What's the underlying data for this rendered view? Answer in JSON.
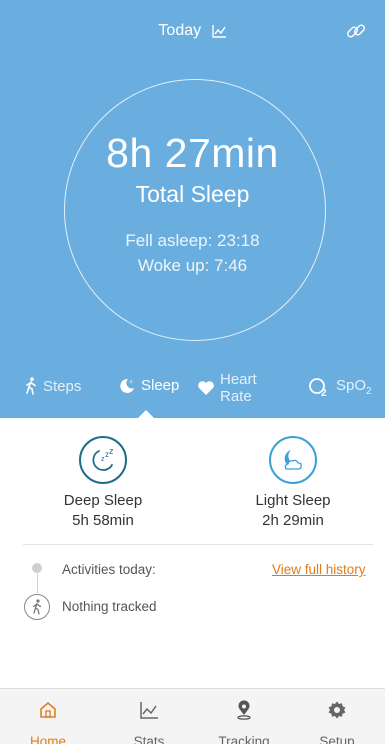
{
  "header": {
    "title": "Today",
    "title_icon": "line-chart-icon",
    "right_icon": "link-icon"
  },
  "summary": {
    "total_time": "8h 27min",
    "total_label": "Total Sleep",
    "fell_asleep": "Fell asleep: 23:18",
    "woke_up": "Woke up: 7:46"
  },
  "tabs": [
    {
      "label": "Steps",
      "icon": "walking-icon"
    },
    {
      "label": "Sleep",
      "icon": "moon-icon",
      "active": true
    },
    {
      "label_line1": "Heart",
      "label_line2": "Rate",
      "icon": "heart-icon"
    },
    {
      "label": "SpO",
      "label_sub": "2",
      "icon": "o2-icon"
    }
  ],
  "deep_sleep": {
    "label": "Deep Sleep",
    "duration": "5h 58min",
    "icon": "zzz-moon-icon"
  },
  "light_sleep": {
    "label": "Light Sleep",
    "duration": "2h 29min",
    "icon": "moon-cloud-icon"
  },
  "activities": {
    "label": "Activities today:",
    "history_link": "View full history",
    "empty_text": "Nothing tracked"
  },
  "nav": [
    {
      "label": "Home",
      "icon": "home-icon",
      "active": true
    },
    {
      "label": "Stats",
      "icon": "stats-icon"
    },
    {
      "label": "Tracking",
      "icon": "location-pin-icon"
    },
    {
      "label": "Setup",
      "icon": "gear-icon"
    }
  ],
  "colors": {
    "header_bg": "#6aaedf",
    "accent_orange": "#e07b1a",
    "deep_sleep": "#1f6d8c",
    "light_sleep": "#3da0d8"
  }
}
